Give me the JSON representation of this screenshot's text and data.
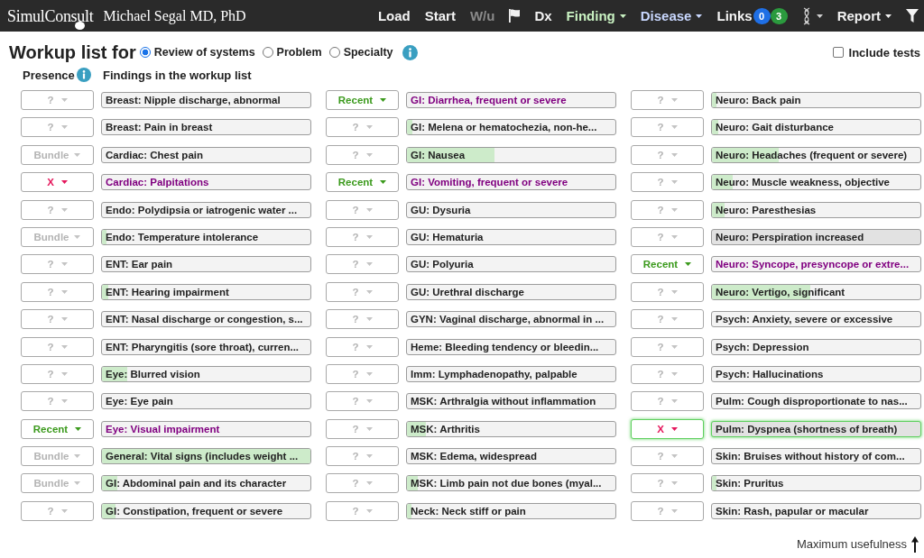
{
  "navbar": {
    "logo": "SimulConsult",
    "user": "Michael Segal MD, PhD",
    "items": [
      {
        "kind": "link",
        "label": "Load",
        "disabled": false
      },
      {
        "kind": "link",
        "label": "Start",
        "disabled": false
      },
      {
        "kind": "link",
        "label": "W/u",
        "disabled": true
      },
      {
        "kind": "flag"
      },
      {
        "kind": "link",
        "label": "Dx",
        "disabled": false
      },
      {
        "kind": "menu",
        "label": "Finding",
        "color": "#c9f2c2"
      },
      {
        "kind": "menu",
        "label": "Disease",
        "color": "#c9d8ff"
      },
      {
        "kind": "links",
        "label": "Links",
        "badges": [
          {
            "text": "0",
            "color": "#1f6fe5"
          },
          {
            "text": "3",
            "color": "#2b9a3e"
          }
        ]
      },
      {
        "kind": "dna"
      },
      {
        "kind": "menu",
        "label": "Report",
        "color": "#f2f2f2"
      },
      {
        "kind": "filter"
      }
    ]
  },
  "workup": {
    "title": "Workup list for",
    "modes": [
      {
        "label": "Review of systems",
        "selected": true
      },
      {
        "label": "Problem",
        "selected": false
      },
      {
        "label": "Specialty",
        "selected": false
      }
    ],
    "include_tests": {
      "label": "Include tests",
      "checked": false
    }
  },
  "list_header": {
    "presence": "Presence",
    "findings": "Findings in the workup list"
  },
  "columns": [
    {
      "rows": [
        {
          "presence": "?",
          "kind": "unset",
          "finding": "Breast: Nipple discharge, abnormal",
          "color": "#222222",
          "highlighted": false,
          "focused": false
        },
        {
          "presence": "?",
          "kind": "unset",
          "finding": "Breast: Pain in breast",
          "color": "#222222",
          "highlighted": false,
          "focused": false
        },
        {
          "presence": "Bundle",
          "kind": "bundle",
          "finding": "Cardiac: Chest pain",
          "color": "#222222",
          "highlighted": false,
          "focused": false
        },
        {
          "presence": "X",
          "kind": "absent",
          "finding": "Cardiac: Palpitations",
          "color": "#800080",
          "highlighted": false,
          "focused": false
        },
        {
          "presence": "?",
          "kind": "unset",
          "finding": "Endo: Polydipsia or iatrogenic water ...",
          "color": "#222222",
          "highlighted": false,
          "focused": false
        },
        {
          "presence": "Bundle",
          "kind": "bundle",
          "finding": "Endo: Temperature intolerance",
          "color": "#222222",
          "level": 0.02,
          "highlighted": false,
          "focused": false
        },
        {
          "presence": "?",
          "kind": "unset",
          "finding": "ENT: Ear pain",
          "color": "#222222",
          "highlighted": false,
          "focused": false
        },
        {
          "presence": "?",
          "kind": "unset",
          "finding": "ENT: Hearing impairment",
          "color": "#222222",
          "level": 0.03,
          "highlighted": false,
          "focused": false
        },
        {
          "presence": "?",
          "kind": "unset",
          "finding": "ENT: Nasal discharge or congestion, s...",
          "color": "#222222",
          "highlighted": false,
          "focused": false
        },
        {
          "presence": "?",
          "kind": "unset",
          "finding": "ENT: Pharyngitis (sore throat), curren...",
          "color": "#222222",
          "highlighted": false,
          "focused": false
        },
        {
          "presence": "?",
          "kind": "unset",
          "finding": "Eye: Blurred vision",
          "color": "#222222",
          "level": 0.12,
          "highlighted": false,
          "focused": false
        },
        {
          "presence": "?",
          "kind": "unset",
          "finding": "Eye: Eye pain",
          "color": "#222222",
          "highlighted": false,
          "focused": false
        },
        {
          "presence": "Recent",
          "kind": "recent",
          "finding": "Eye: Visual impairment",
          "color": "#800080",
          "highlighted": false,
          "focused": false
        },
        {
          "presence": "Bundle",
          "kind": "bundle",
          "finding": "General: Vital signs (includes weight ...",
          "color": "#222222",
          "level": 1,
          "highlighted": false,
          "focused": false
        },
        {
          "presence": "Bundle",
          "kind": "bundle",
          "finding": "GI: Abdominal pain and its character",
          "color": "#222222",
          "level": 0.075,
          "highlighted": false,
          "focused": false
        },
        {
          "presence": "?",
          "kind": "unset",
          "finding": "GI: Constipation, frequent or severe",
          "color": "#222222",
          "level": 0.065,
          "highlighted": false,
          "focused": false
        }
      ]
    },
    {
      "rows": [
        {
          "presence": "Recent",
          "kind": "recent",
          "finding": "GI: Diarrhea, frequent or severe",
          "color": "#800080",
          "highlighted": false,
          "focused": false
        },
        {
          "presence": "?",
          "kind": "unset",
          "finding": "GI: Melena or hematochezia, non-he...",
          "color": "#222222",
          "level": 0.025,
          "highlighted": false,
          "focused": false
        },
        {
          "presence": "?",
          "kind": "unset",
          "finding": "GI: Nausea",
          "color": "#222222",
          "level": 0.42,
          "highlighted": false,
          "focused": false
        },
        {
          "presence": "Recent",
          "kind": "recent",
          "finding": "GI: Vomiting, frequent or severe",
          "color": "#800080",
          "highlighted": false,
          "focused": false
        },
        {
          "presence": "?",
          "kind": "unset",
          "finding": "GU: Dysuria",
          "color": "#222222",
          "highlighted": false,
          "focused": false
        },
        {
          "presence": "?",
          "kind": "unset",
          "finding": "GU: Hematuria",
          "color": "#222222",
          "highlighted": false,
          "focused": false
        },
        {
          "presence": "?",
          "kind": "unset",
          "finding": "GU: Polyuria",
          "color": "#222222",
          "highlighted": false,
          "focused": false
        },
        {
          "presence": "?",
          "kind": "unset",
          "finding": "GU: Urethral discharge",
          "color": "#222222",
          "highlighted": false,
          "focused": false
        },
        {
          "presence": "?",
          "kind": "unset",
          "finding": "GYN: Vaginal discharge, abnormal in ...",
          "color": "#222222",
          "highlighted": false,
          "focused": false
        },
        {
          "presence": "?",
          "kind": "unset",
          "finding": "Heme: Bleeding tendency or bleedin...",
          "color": "#222222",
          "highlighted": false,
          "focused": false
        },
        {
          "presence": "?",
          "kind": "unset",
          "finding": "Imm: Lymphadenopathy, palpable",
          "color": "#222222",
          "highlighted": false,
          "focused": false
        },
        {
          "presence": "?",
          "kind": "unset",
          "finding": "MSK: Arthralgia without inflammation",
          "color": "#222222",
          "highlighted": false,
          "focused": false
        },
        {
          "presence": "?",
          "kind": "unset",
          "finding": "MSK: Arthritis",
          "color": "#222222",
          "level": 0.09,
          "highlighted": false,
          "focused": false
        },
        {
          "presence": "?",
          "kind": "unset",
          "finding": "MSK: Edema, widespread",
          "color": "#222222",
          "highlighted": false,
          "focused": false
        },
        {
          "presence": "?",
          "kind": "unset",
          "finding": "MSK: Limb pain not due bones (myal...",
          "color": "#222222",
          "level": 0.05,
          "highlighted": false,
          "focused": false
        },
        {
          "presence": "?",
          "kind": "unset",
          "finding": "Neck: Neck stiff or pain",
          "color": "#222222",
          "level": 0.02,
          "highlighted": false,
          "focused": false
        }
      ]
    },
    {
      "rows": [
        {
          "presence": "?",
          "kind": "unset",
          "finding": "Neuro: Back pain",
          "color": "#222222",
          "level": 0.02,
          "highlighted": false,
          "focused": false
        },
        {
          "presence": "?",
          "kind": "unset",
          "finding": "Neuro: Gait disturbance",
          "color": "#222222",
          "level": 0.03,
          "highlighted": false,
          "focused": false
        },
        {
          "presence": "?",
          "kind": "unset",
          "finding": "Neuro: Headaches (frequent or severe)",
          "color": "#222222",
          "level": 0.32,
          "highlighted": false,
          "focused": false
        },
        {
          "presence": "?",
          "kind": "unset",
          "finding": "Neuro: Muscle weakness, objective",
          "color": "#222222",
          "level": 0.1,
          "highlighted": false,
          "focused": false
        },
        {
          "presence": "?",
          "kind": "unset",
          "finding": "Neuro: Paresthesias",
          "color": "#222222",
          "level": 0.06,
          "highlighted": false,
          "focused": false
        },
        {
          "presence": "?",
          "kind": "unset",
          "finding": "Neuro: Perspiration increased",
          "color": "#222222",
          "highlighted": true,
          "focused": false
        },
        {
          "presence": "Recent",
          "kind": "recent",
          "finding": "Neuro: Syncope, presyncope or extre...",
          "color": "#800080",
          "highlighted": false,
          "focused": false
        },
        {
          "presence": "?",
          "kind": "unset",
          "finding": "Neuro: Vertigo, significant",
          "color": "#222222",
          "level": 0.47,
          "highlighted": false,
          "focused": false
        },
        {
          "presence": "?",
          "kind": "unset",
          "finding": "Psych: Anxiety, severe or excessive",
          "color": "#222222",
          "highlighted": false,
          "focused": false
        },
        {
          "presence": "?",
          "kind": "unset",
          "finding": "Psych: Depression",
          "color": "#222222",
          "highlighted": false,
          "focused": false
        },
        {
          "presence": "?",
          "kind": "unset",
          "finding": "Psych: Hallucinations",
          "color": "#222222",
          "highlighted": false,
          "focused": false
        },
        {
          "presence": "?",
          "kind": "unset",
          "finding": "Pulm: Cough disproportionate to nas...",
          "color": "#222222",
          "highlighted": false,
          "focused": false
        },
        {
          "presence": "X",
          "kind": "absent",
          "finding": "Pulm: Dyspnea (shortness of breath)",
          "color": "#222222",
          "highlighted": true,
          "focused": true
        },
        {
          "presence": "?",
          "kind": "unset",
          "finding": "Skin: Bruises without history of com...",
          "color": "#222222",
          "highlighted": false,
          "focused": false
        },
        {
          "presence": "?",
          "kind": "unset",
          "finding": "Skin: Pruritus",
          "color": "#222222",
          "level": 0.02,
          "highlighted": false,
          "focused": false
        },
        {
          "presence": "?",
          "kind": "unset",
          "finding": "Skin: Rash, papular or macular",
          "color": "#222222",
          "highlighted": false,
          "focused": false
        }
      ]
    }
  ],
  "footer": {
    "caption": "Maximum usefulness"
  }
}
